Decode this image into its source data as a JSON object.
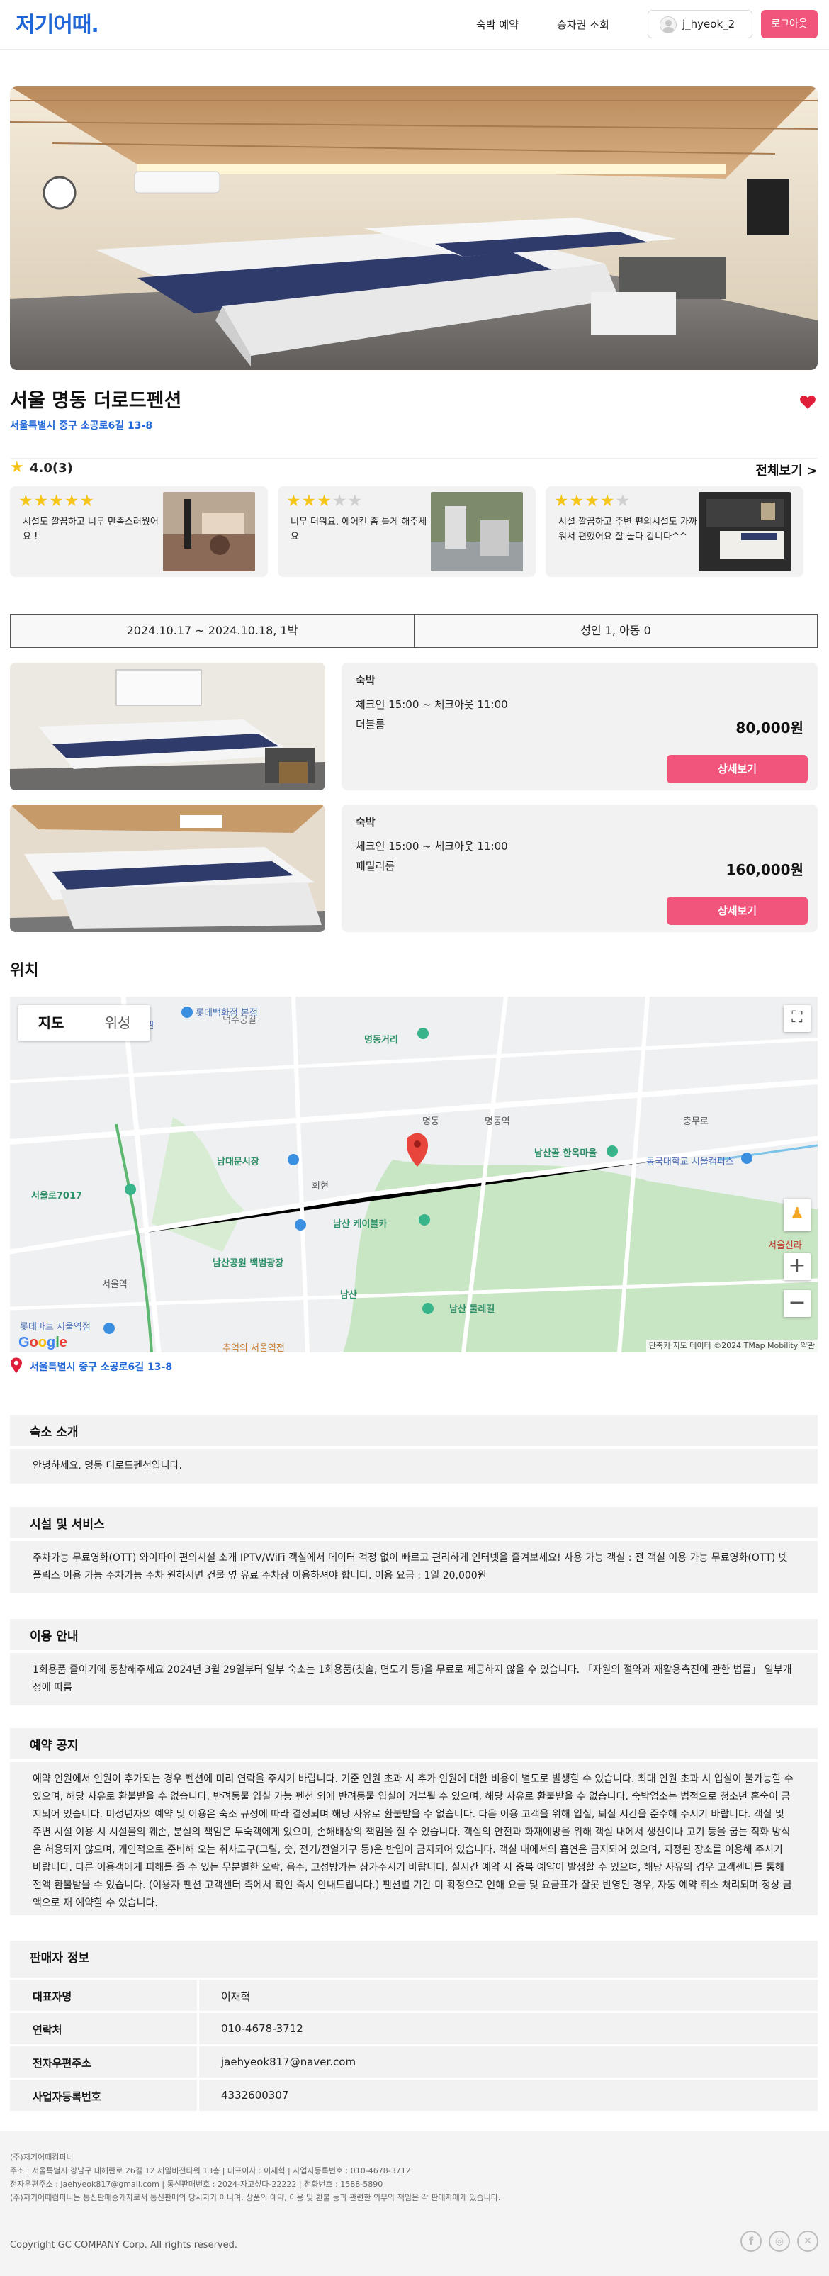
{
  "header": {
    "logo": "저기어때.",
    "nav": [
      "숙박 예약",
      "승차권 조회"
    ],
    "username": "j_hyeok_2",
    "logout_label": "로그아웃"
  },
  "property": {
    "name": "서울 명동 더로드펜션",
    "address": "서울특별시 중구 소공로6길 13-8",
    "rating": "4.0(3)",
    "see_all": "전체보기 >"
  },
  "reviews": [
    {
      "stars": 5,
      "text": "시설도 깔끔하고 너무 만족스러웠어요 !"
    },
    {
      "stars": 3,
      "text": "너무 더워요. 에어컨 좀 틀게 해주세요"
    },
    {
      "stars": 4,
      "text": "시설 깔끔하고 주변 편의시설도 가까워서 편했어요 잘 놀다 갑니다^^"
    }
  ],
  "search": {
    "dates": "2024.10.17 ~ 2024.10.18, 1박",
    "guests": "성인 1, 아동 0"
  },
  "rooms": [
    {
      "type": "숙박",
      "time": "체크인 15:00 ~ 체크아웃 11:00",
      "name": "더블룸",
      "price": "80,000원",
      "button": "상세보기"
    },
    {
      "type": "숙박",
      "time": "체크인 15:00 ~ 체크아웃 11:00",
      "name": "패밀리룸",
      "price": "160,000원",
      "button": "상세보기"
    }
  ],
  "location": {
    "title": "위치",
    "map_tabs": [
      "지도",
      "위성"
    ],
    "attribution": "단축키   지도 데이터 ©2024 TMap Mobility   약관",
    "pin_address": "서울특별시 중구 소공로6길 13-8",
    "labels": {
      "lotte": "롯데백화점 본점",
      "myeongdong_street": "명동거리",
      "myeongdong": "명동",
      "namsangol": "남산골 한옥마을",
      "dongguk": "동국대학교 서울캠퍼스",
      "namdaemun": "남대문시장",
      "hoehyeon": "회현",
      "cablecar": "남산 케이블카",
      "baekbeom": "남산공원 백범광장",
      "namsan": "남산",
      "dulle": "남산 둘레길",
      "seoul_station": "서울역",
      "seoullo": "서울로7017",
      "chungmuro": "충무로",
      "art": "미술관",
      "lotte_mart": "롯데마트 서울역점",
      "seoul_shilla": "서울신라",
      "chueo": "추억의 서울역전",
      "deoksugung": "덕수궁길",
      "myeongdong_station": "명동역"
    }
  },
  "sections": [
    {
      "title": "숙소 소개",
      "body": "안녕하세요. 명동 더로드펜션입니다."
    },
    {
      "title": "시설 및 서비스",
      "body": "주차가능 무료영화(OTT) 와이파이 편의시설 소개 IPTV/WiFi 객실에서 데이터 걱정 없이 빠르고 편리하게 인터넷을 즐겨보세요! 사용 가능 객실 : 전 객실 이용 가능 무료영화(OTT) 넷플릭스 이용 가능 주차가능 주차 원하시면 건물 옆 유료 주차장 이용하셔야 합니다. 이용 요금 : 1일 20,000원"
    },
    {
      "title": "이용 안내",
      "body": "1회용품 줄이기에 동참해주세요 2024년 3월 29일부터 일부 숙소는 1회용품(칫솔, 면도기 등)을 무료로 제공하지 않을 수 있습니다. 「자원의 절약과 재활용촉진에 관한 법률」 일부개정에 따름"
    },
    {
      "title": "예약 공지",
      "body": "예약 인원에서 인원이 추가되는 경우 펜션에 미리 연락을 주시기 바랍니다. 기준 인원 초과 시 추가 인원에 대한 비용이 별도로 발생할 수 있습니다. 최대 인원 초과 시 입실이 불가능할 수 있으며, 해당 사유로 환불받을 수 없습니다. 반려동물 입실 가능 펜션 외에 반려동물 입실이 거부될 수 있으며, 해당 사유로 환불받을 수 없습니다. 숙박업소는 법적으로 청소년 혼숙이 금지되어 있습니다. 미성년자의 예약 및 이용은 숙소 규정에 따라 결정되며 해당 사유로 환불받을 수 없습니다. 다음 이용 고객을 위해 입실, 퇴실 시간을 준수해 주시기 바랍니다. 객실 및 주변 시설 이용 시 시설물의 훼손, 분실의 책임은 투숙객에게 있으며, 손해배상의 책임을 질 수 있습니다. 객실의 안전과 화재예방을 위해 객실 내에서 생선이나 고기 등을 굽는 직화 방식은 허용되지 않으며, 개인적으로 준비해 오는 취사도구(그릴, 숯, 전기/전열기구 등)은 반입이 금지되어 있습니다. 객실 내에서의 흡연은 금지되어 있으며, 지정된 장소를 이용해 주시기 바랍니다. 다른 이용객에게 피해를 줄 수 있는 무분별한 오락, 음주, 고성방가는 삼가주시기 바랍니다. 실시간 예약 시 중복 예약이 발생할 수 있으며, 해당 사유의 경우 고객센터를 통해 전액 환불받을 수 있습니다. (이용자 펜션 고객센터 측에서 확인 즉시 안내드립니다.) 펜션별 기간 미 확정으로 인해 요금 및 요금표가 잘못 반영된 경우, 자동 예약 취소 처리되며 정상 금액으로 재 예약할 수 있습니다."
    }
  ],
  "seller": {
    "title": "판매자 정보",
    "rows": [
      {
        "key": "대표자명",
        "value": "이재혁"
      },
      {
        "key": "연락처",
        "value": "010-4678-3712"
      },
      {
        "key": "전자우편주소",
        "value": "jaehyeok817@naver.com"
      },
      {
        "key": "사업자등록번호",
        "value": "4332600307"
      }
    ]
  },
  "footer": {
    "lines": [
      "(주)저기어때컴퍼니",
      "주소 : 서울특별시 강남구 테헤란로 26길 12 제일비전타워 13층 | 대표이사 : 이재혁 | 사업자등록번호 : 010-4678-3712",
      "전자우편주소 : jaehyeok817@gmail.com | 통신판매번호 : 2024-자고싶다-22222 | 전화번호 : 1588-5890",
      "(주)저기어때컴퍼니는 통신판매중개자로서 통신판매의 당사자가 아니며, 상품의 예약, 이용 및 환불 등과 관련한 의무와 책임은 각 판매자에게 있습니다."
    ],
    "copyright": "Copyright GC COMPANY Corp. All rights reserved.",
    "social_icons": [
      "facebook-icon",
      "instagram-icon",
      "x-icon"
    ]
  },
  "colors": {
    "brand": "#1f66d6",
    "accent": "#f2557c",
    "star": "#f5c518",
    "heart": "#e0203a"
  }
}
